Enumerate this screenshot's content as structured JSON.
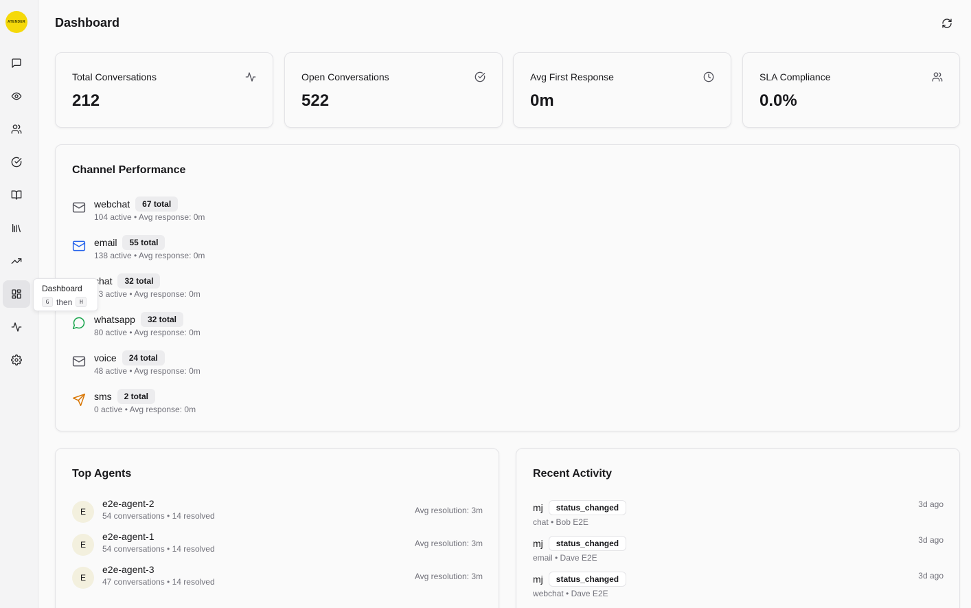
{
  "app": {
    "logo_text": "ATENDER"
  },
  "header": {
    "title": "Dashboard"
  },
  "tooltip": {
    "title": "Dashboard",
    "key1": "G",
    "then": "then",
    "key2": "H"
  },
  "stats": [
    {
      "label": "Total Conversations",
      "value": "212",
      "icon": "activity-icon"
    },
    {
      "label": "Open Conversations",
      "value": "522",
      "icon": "check-circle-icon"
    },
    {
      "label": "Avg First Response",
      "value": "0m",
      "icon": "clock-icon"
    },
    {
      "label": "SLA Compliance",
      "value": "0.0%",
      "icon": "users-icon"
    }
  ],
  "channel_performance": {
    "title": "Channel Performance",
    "channels": [
      {
        "name": "webchat",
        "total": "67 total",
        "sub": "104 active • Avg response: 0m",
        "icon": "mail-icon",
        "color": "#52525b"
      },
      {
        "name": "email",
        "total": "55 total",
        "sub": "138 active • Avg response: 0m",
        "icon": "mail-icon",
        "color": "#2563eb"
      },
      {
        "name": "chat",
        "total": "32 total",
        "sub": "33 active • Avg response: 0m",
        "icon": "chat-icon",
        "color": "#52525b"
      },
      {
        "name": "whatsapp",
        "total": "32 total",
        "sub": "80 active • Avg response: 0m",
        "icon": "message-circle-icon",
        "color": "#16a34a"
      },
      {
        "name": "voice",
        "total": "24 total",
        "sub": "48 active • Avg response: 0m",
        "icon": "mail-icon",
        "color": "#52525b"
      },
      {
        "name": "sms",
        "total": "2 total",
        "sub": "0 active • Avg response: 0m",
        "icon": "send-icon",
        "color": "#d97706"
      }
    ]
  },
  "top_agents": {
    "title": "Top Agents",
    "agents": [
      {
        "initial": "E",
        "name": "e2e-agent-2",
        "sub": "54 conversations • 14 resolved",
        "resolution": "Avg resolution: 3m"
      },
      {
        "initial": "E",
        "name": "e2e-agent-1",
        "sub": "54 conversations • 14 resolved",
        "resolution": "Avg resolution: 3m"
      },
      {
        "initial": "E",
        "name": "e2e-agent-3",
        "sub": "47 conversations • 14 resolved",
        "resolution": "Avg resolution: 3m"
      }
    ]
  },
  "recent_activity": {
    "title": "Recent Activity",
    "items": [
      {
        "user": "mj",
        "action": "status_changed",
        "sub": "chat • Bob E2E",
        "time": "3d ago"
      },
      {
        "user": "mj",
        "action": "status_changed",
        "sub": "email • Dave E2E",
        "time": "3d ago"
      },
      {
        "user": "mj",
        "action": "status_changed",
        "sub": "webchat • Dave E2E",
        "time": "3d ago"
      }
    ]
  }
}
